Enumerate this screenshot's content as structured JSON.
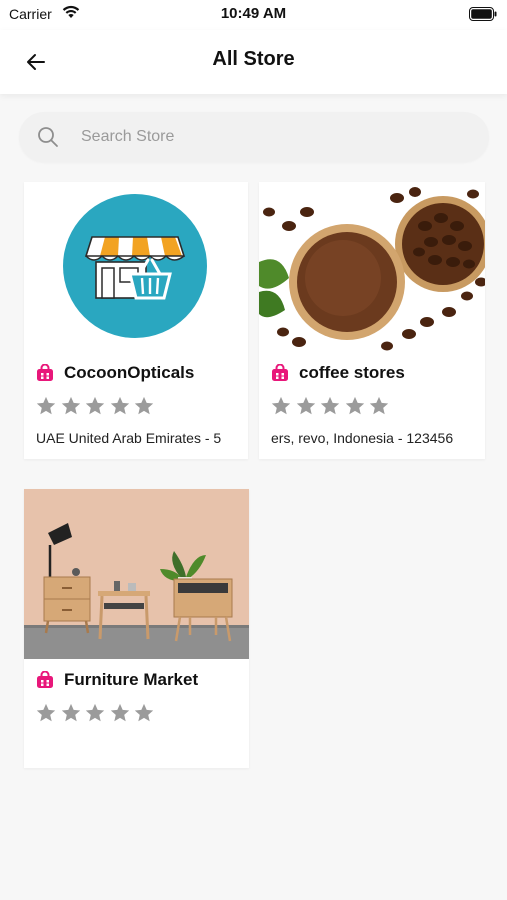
{
  "status_bar": {
    "carrier": "Carrier",
    "time": "10:49 AM"
  },
  "header": {
    "title": "All Store"
  },
  "search": {
    "placeholder": "Search Store"
  },
  "stores": [
    {
      "name": "CocoonOpticals",
      "address": "UAE United Arab Emirates - 5",
      "rating": 0,
      "image": "store-logo"
    },
    {
      "name": "coffee stores",
      "address": "ers, revo,  Indonesia - 123456",
      "rating": 0,
      "image": "coffee-beans-photo"
    },
    {
      "name": "Furniture Market",
      "address": "",
      "rating": 0,
      "image": "furniture-photo"
    }
  ],
  "colors": {
    "accent": "#e8177a",
    "star": "#9b9b9b",
    "logo_bg": "#2aa7c0"
  }
}
